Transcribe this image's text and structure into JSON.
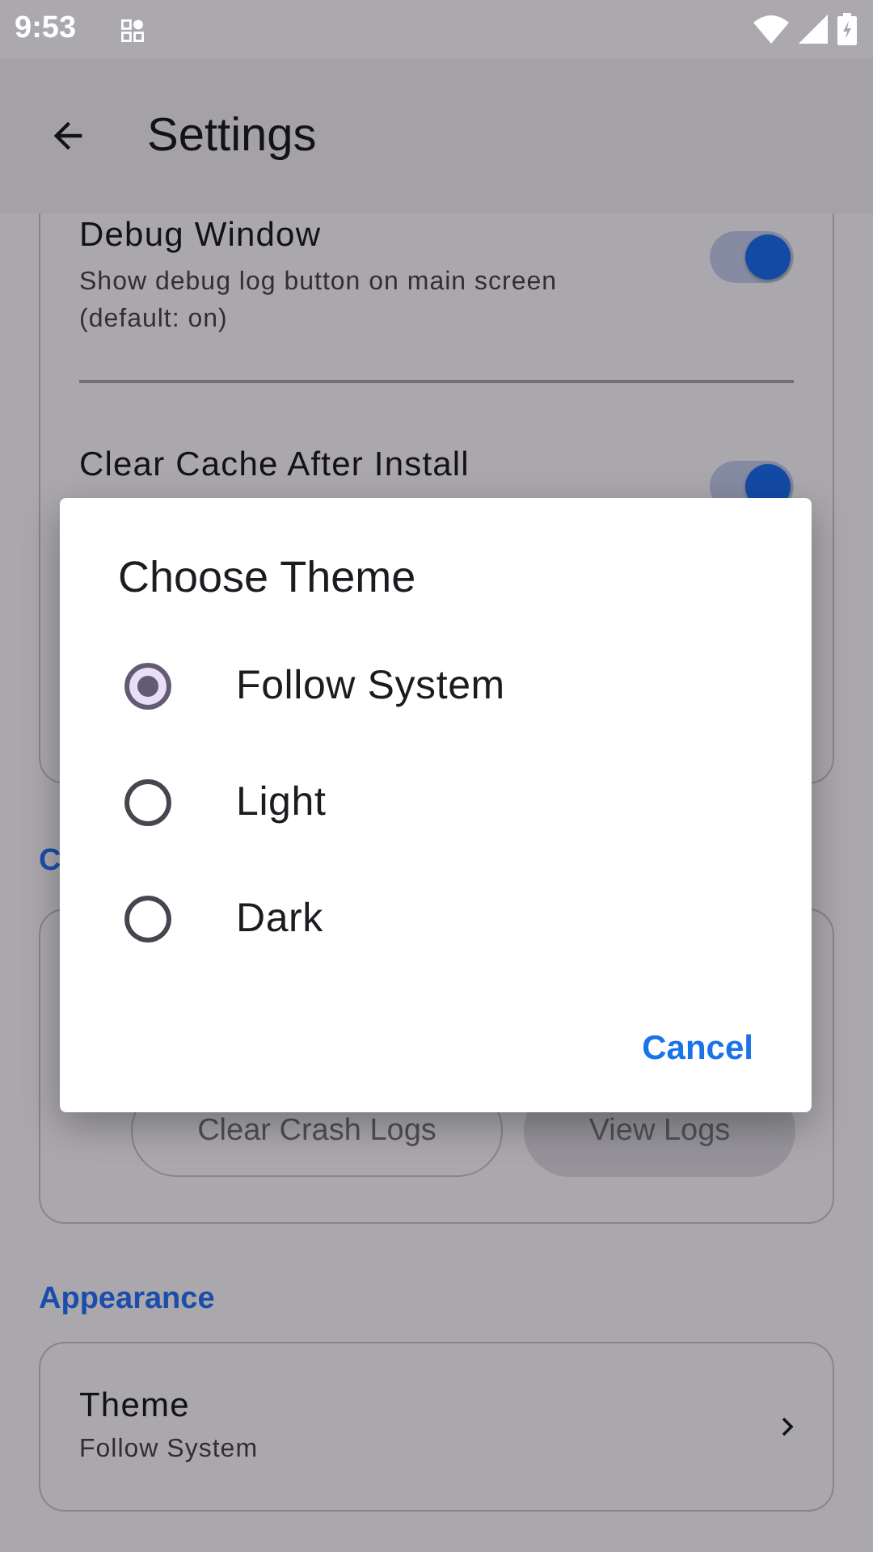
{
  "status_bar": {
    "time": "9:53"
  },
  "app_bar": {
    "title": "Settings"
  },
  "debug_card": {
    "items": [
      {
        "title": "Debug Window",
        "subtitle": "Show debug log button on main screen (default: on)",
        "on": true
      },
      {
        "title": "Clear Cache After Install",
        "on": true
      }
    ]
  },
  "crash_section": {
    "title": "C",
    "buttons": [
      {
        "label": "Clear Crash Logs",
        "kind": "outlined"
      },
      {
        "label": "View Logs",
        "kind": "filled"
      }
    ]
  },
  "appearance_section": {
    "title": "Appearance",
    "item": {
      "title": "Theme",
      "value": "Follow System"
    }
  },
  "dialog": {
    "title": "Choose Theme",
    "options": [
      {
        "label": "Follow System",
        "selected": true
      },
      {
        "label": "Light",
        "selected": false
      },
      {
        "label": "Dark",
        "selected": false
      }
    ],
    "cancel": "Cancel"
  }
}
